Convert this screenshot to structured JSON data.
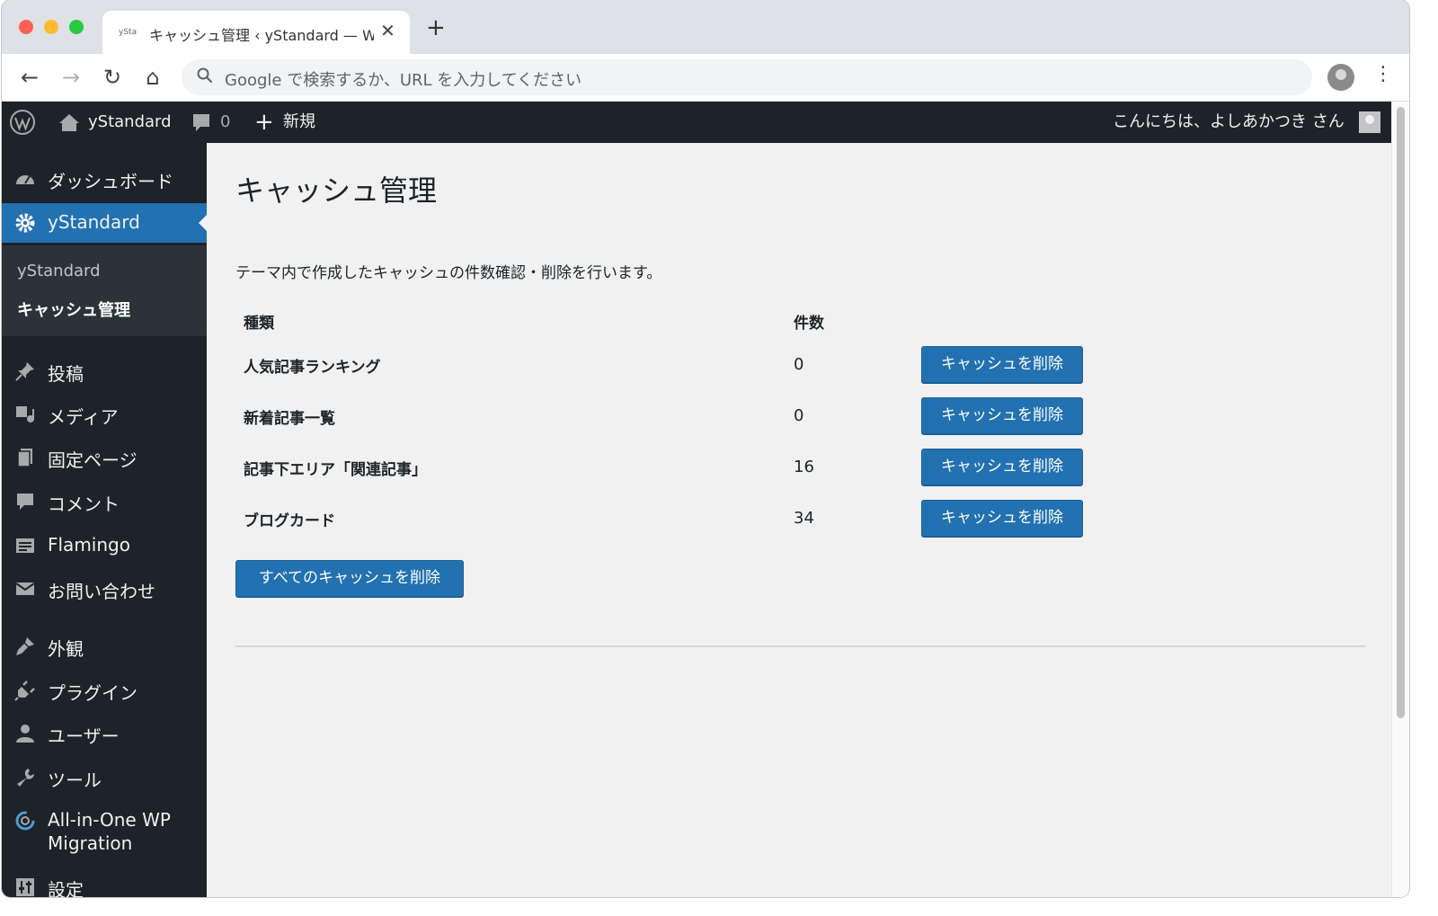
{
  "browser": {
    "tab": {
      "favicon_text": "ySta",
      "title": "キャッシュ管理 ‹ yStandard — W",
      "close": "✕"
    },
    "new_tab": "+",
    "nav": {
      "back": "←",
      "forward": "→",
      "reload": "↻",
      "home": "⌂"
    },
    "omnibox": {
      "placeholder": "Google で検索するか、URL を入力してください"
    },
    "menu": "⋮"
  },
  "adminbar": {
    "site_name": "yStandard",
    "comments_count": "0",
    "plus": "+",
    "new_label": "新規",
    "howdy": "こんにちは、よしあかつき さん"
  },
  "sidebar": {
    "items": [
      {
        "label": "ダッシュボード",
        "icon": "dashboard-icon"
      },
      {
        "label": "yStandard",
        "icon": "gear-icon",
        "active": true
      },
      {
        "label": "投稿",
        "icon": "pin-icon"
      },
      {
        "label": "メディア",
        "icon": "media-icon"
      },
      {
        "label": "固定ページ",
        "icon": "pages-icon"
      },
      {
        "label": "コメント",
        "icon": "comment-icon"
      },
      {
        "label": "Flamingo",
        "icon": "flamingo-icon"
      },
      {
        "label": "お問い合わせ",
        "icon": "mail-icon"
      },
      {
        "label": "外観",
        "icon": "brush-icon"
      },
      {
        "label": "プラグイン",
        "icon": "plugin-icon"
      },
      {
        "label": "ユーザー",
        "icon": "user-icon"
      },
      {
        "label": "ツール",
        "icon": "wrench-icon"
      },
      {
        "label": "All-in-One WP",
        "label2": "Migration",
        "icon": "migration-icon"
      },
      {
        "label": "設定",
        "icon": "settings-icon"
      }
    ],
    "submenu": [
      {
        "label": "yStandard"
      },
      {
        "label": "キャッシュ管理",
        "current": true
      }
    ]
  },
  "main": {
    "title": "キャッシュ管理",
    "description": "テーマ内で作成したキャッシュの件数確認・削除を行います。",
    "table": {
      "headers": {
        "type": "種類",
        "count": "件数"
      },
      "rows": [
        {
          "name": "人気記事ランキング",
          "count": "0",
          "button": "キャッシュを削除"
        },
        {
          "name": "新着記事一覧",
          "count": "0",
          "button": "キャッシュを削除"
        },
        {
          "name": "記事下エリア「関連記事」",
          "count": "16",
          "button": "キャッシュを削除"
        },
        {
          "name": "ブログカード",
          "count": "34",
          "button": "キャッシュを削除"
        }
      ]
    },
    "delete_all": "すべてのキャッシュを削除"
  },
  "colors": {
    "admin_dark": "#1d2327",
    "accent": "#2271b1",
    "content_bg": "#f1f1f1"
  }
}
